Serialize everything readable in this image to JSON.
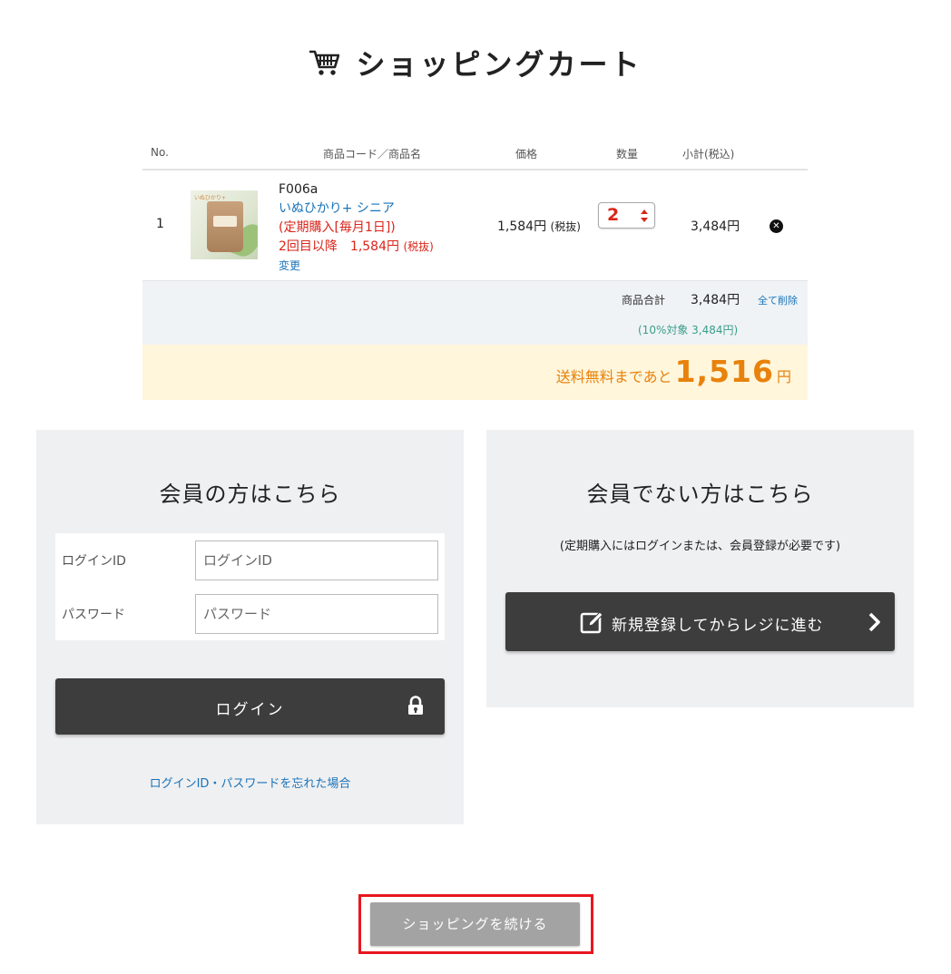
{
  "title": "ショッピングカート",
  "cart": {
    "headers": {
      "no": "No.",
      "product": "商品コード／商品名",
      "price": "価格",
      "qty": "数量",
      "subtotal": "小計(税込)"
    },
    "items": [
      {
        "no": "1",
        "image_caption": "いぬひかり+",
        "code": "F006a",
        "name": "いぬひかり+ シニア",
        "plan": "(定期購入[毎月1日])",
        "from_second": "2回目以降　1,584円",
        "from_second_tax": "(税抜)",
        "change": "変更",
        "price": "1,584円",
        "price_tax": "(税抜)",
        "quantity": "2",
        "subtotal": "3,484円"
      }
    ],
    "totals": {
      "label": "商品合計",
      "value": "3,484円",
      "clear_all": "全て削除",
      "tax_note": "(10%対象 3,484円)"
    },
    "shipping": {
      "lead": "送料無料まであと",
      "amount": "1,516",
      "unit": "円"
    }
  },
  "member": {
    "heading": "会員の方はこちら",
    "login_id_label": "ログインID",
    "login_id_placeholder": "ログインID",
    "password_label": "パスワード",
    "password_placeholder": "パスワード",
    "login_button": "ログイン",
    "forgot_link": "ログインID・パスワードを忘れた場合"
  },
  "guest": {
    "heading": "会員でない方はこちら",
    "note": "(定期購入にはログインまたは、会員登録が必要です)",
    "register_button": "新規登録してからレジに進む"
  },
  "continue_button": "ショッピングを続ける",
  "colors": {
    "link": "#1a73b8",
    "red": "#d9251a",
    "orange": "#e8820c",
    "dark_button": "#3d3d3d",
    "highlight_frame": "#e8161f"
  },
  "icons": [
    "cart-icon",
    "sort-arrows-icon",
    "remove-icon",
    "lock-icon",
    "edit-icon",
    "chevron-right-icon"
  ]
}
